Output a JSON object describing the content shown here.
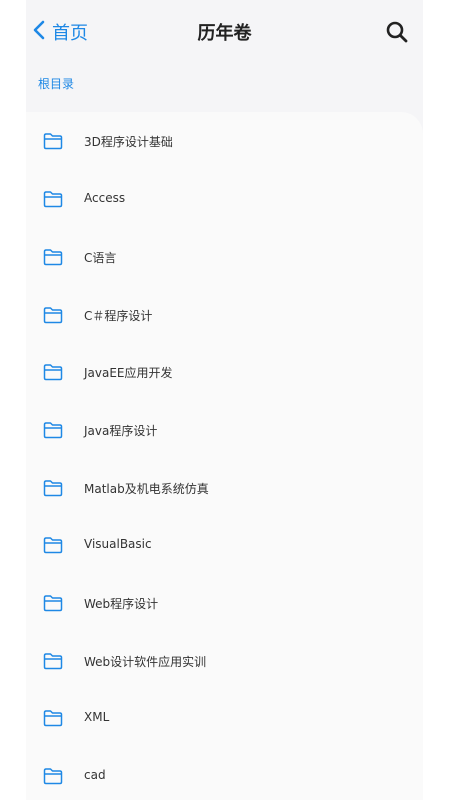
{
  "nav": {
    "back_label": "首页",
    "title": "历年卷",
    "back_icon": "chevron-left-icon",
    "search_icon": "search-icon"
  },
  "breadcrumb": {
    "label": "根目录"
  },
  "colors": {
    "accent": "#1e88e5",
    "folder": "#1e88e5",
    "text": "#333333"
  },
  "folders": [
    {
      "label": "3D程序设计基础",
      "icon": "folder-icon"
    },
    {
      "label": "Access",
      "icon": "folder-icon"
    },
    {
      "label": "C语言",
      "icon": "folder-icon"
    },
    {
      "label": "C＃程序设计",
      "icon": "folder-icon"
    },
    {
      "label": "JavaEE应用开发",
      "icon": "folder-icon"
    },
    {
      "label": "Java程序设计",
      "icon": "folder-icon"
    },
    {
      "label": "Matlab及机电系统仿真",
      "icon": "folder-icon"
    },
    {
      "label": "VisualBasic",
      "icon": "folder-icon"
    },
    {
      "label": "Web程序设计",
      "icon": "folder-icon"
    },
    {
      "label": "Web设计软件应用实训",
      "icon": "folder-icon"
    },
    {
      "label": "XML",
      "icon": "folder-icon"
    },
    {
      "label": "cad",
      "icon": "folder-icon"
    }
  ]
}
